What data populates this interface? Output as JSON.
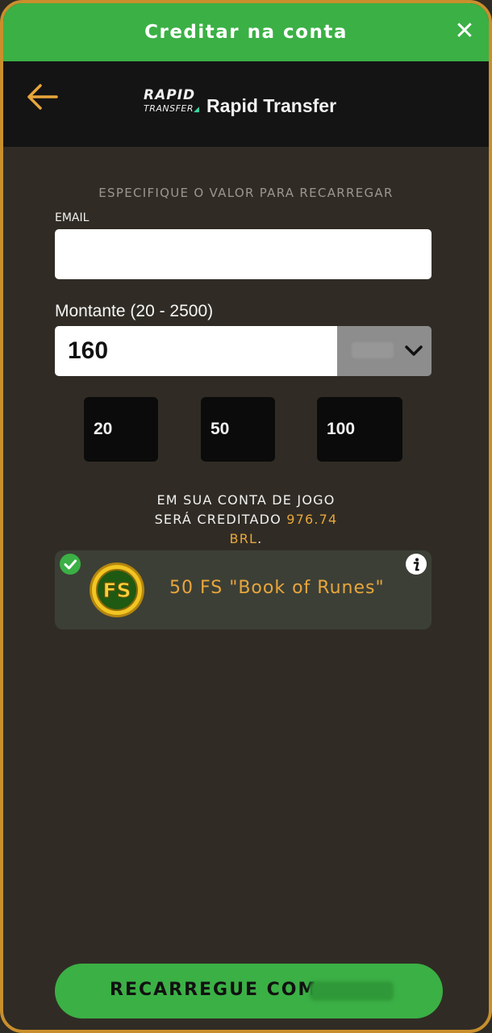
{
  "topbar": {
    "title": "Creditar na conta"
  },
  "header": {
    "title": "Rapid Transfer",
    "logo": {
      "line1": "RAPID",
      "line2": "TRANSFER"
    }
  },
  "form": {
    "subtitle": "ESPECIFIQUE O VALOR PARA RECARREGAR",
    "email_label": "EMAIL",
    "email_value": "",
    "amount_label": "Montante (20 - 2500)",
    "amount_value": "160",
    "currency_value": "",
    "quick_amounts": [
      "20",
      "50",
      "100"
    ]
  },
  "credit": {
    "line1": "EM SUA CONTA DE JOGO",
    "line2_prefix": "SERÁ CREDITADO ",
    "amount": "976.74",
    "currency": "BRL",
    "suffix": "."
  },
  "bonus": {
    "coin_label": "FS",
    "text": "50 FS \"Book of Runes\""
  },
  "submit": {
    "label": "RECARREGUE COM"
  },
  "colors": {
    "accent_green": "#3bb045",
    "accent_orange": "#e8a63c",
    "frame": "#c98f2c",
    "background": "#302c25"
  }
}
